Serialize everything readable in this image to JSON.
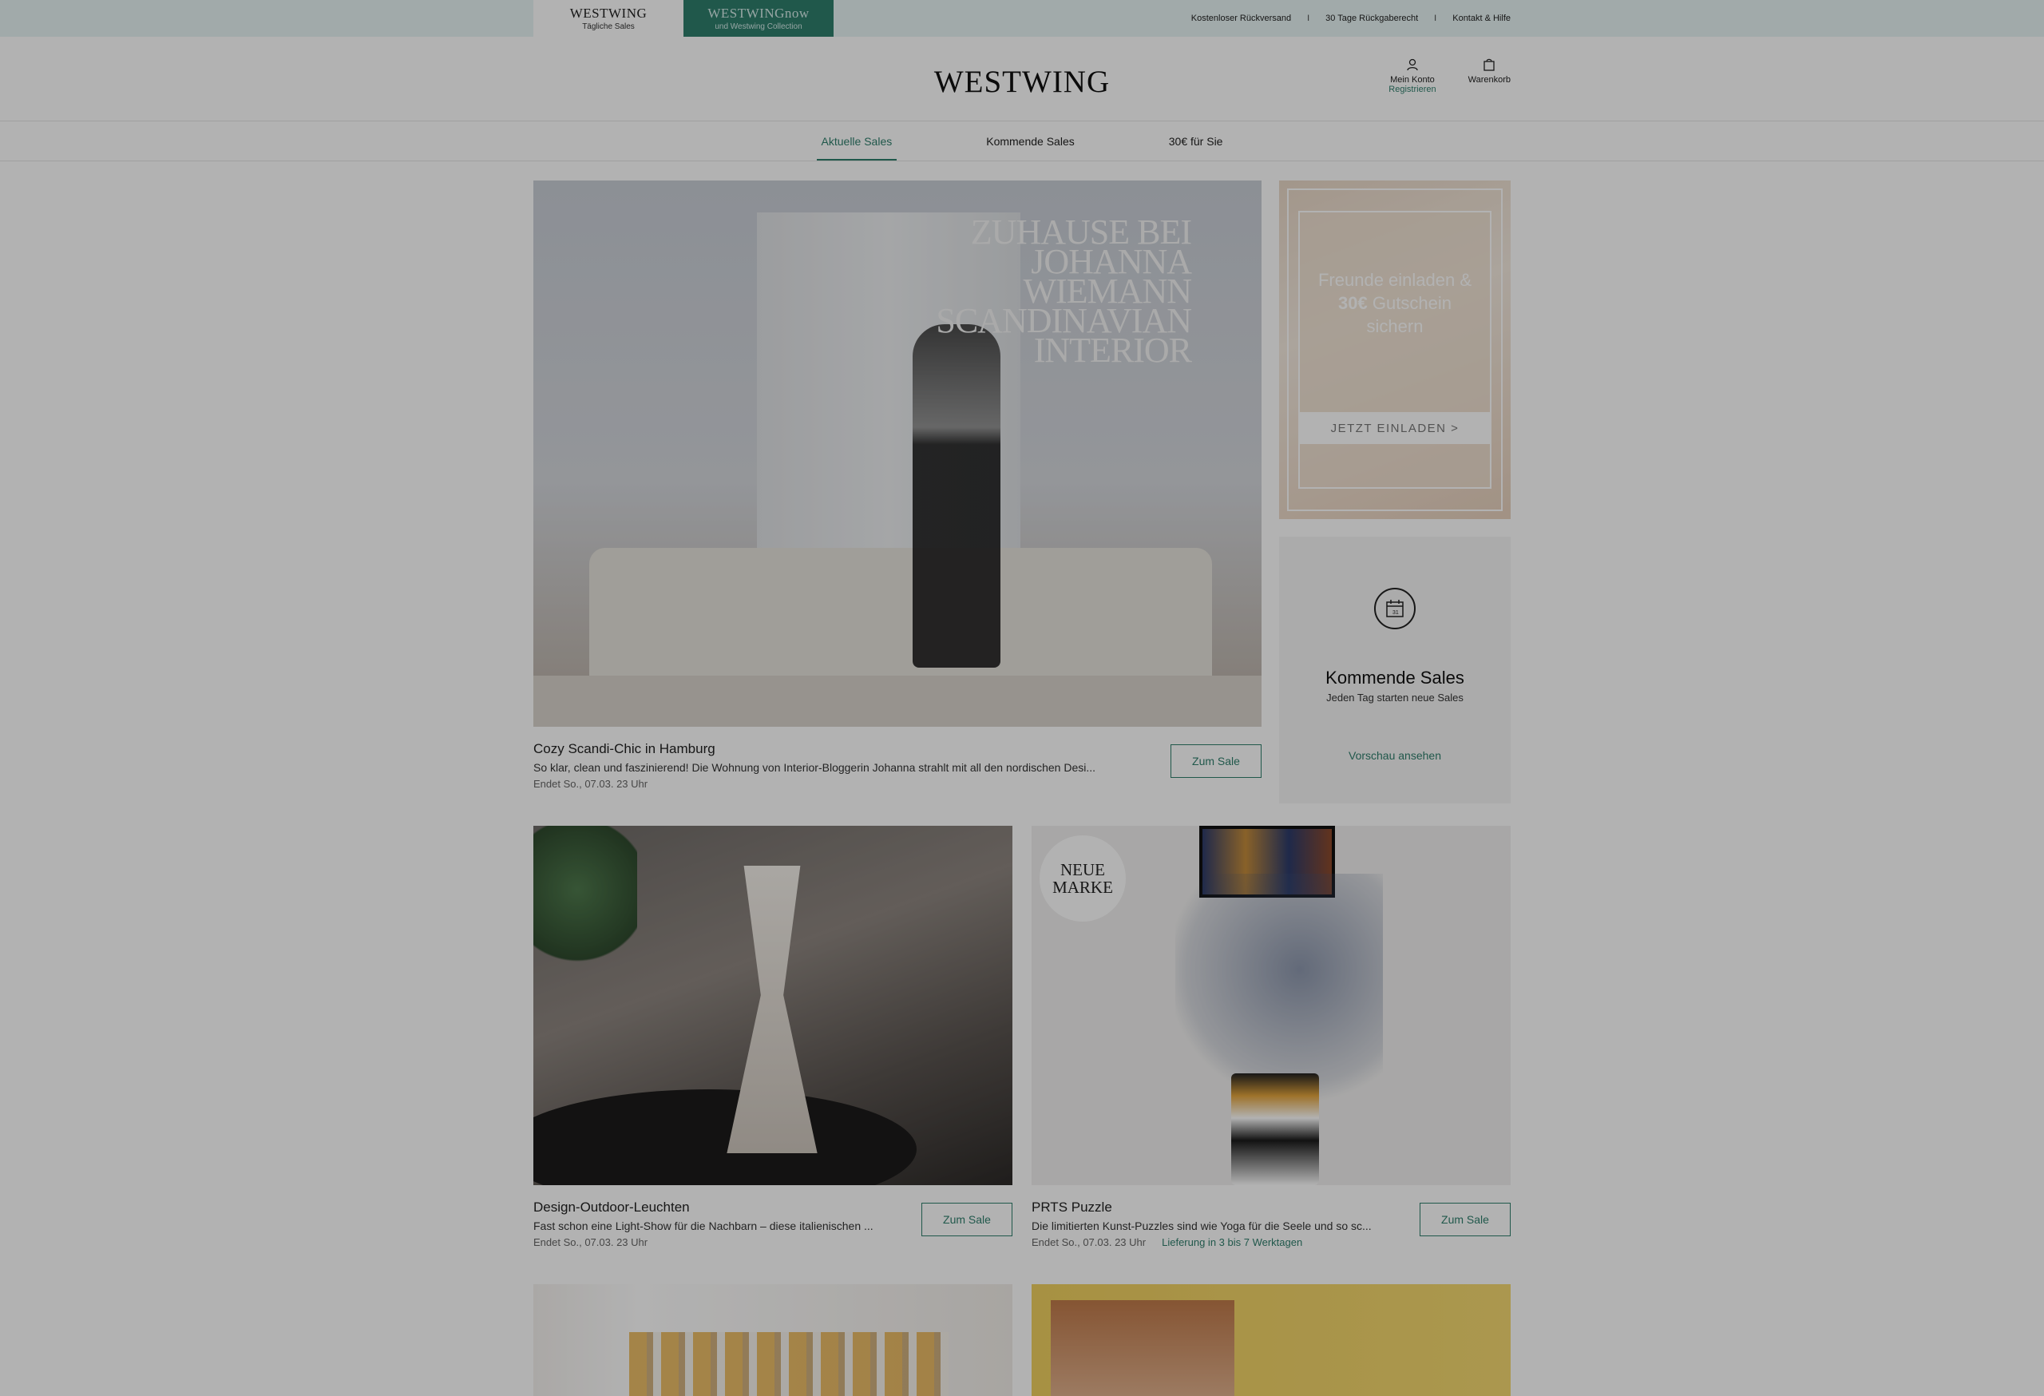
{
  "topbar": {
    "brand_westwing": "WESTWING",
    "brand_westwing_sub": "Tägliche Sales",
    "brand_now": "WESTWINGnow",
    "brand_now_sub": "und Westwing Collection",
    "links": [
      "Kostenloser Rückversand",
      "30 Tage Rückgaberecht",
      "Kontakt & Hilfe"
    ],
    "sep": "I"
  },
  "header": {
    "logo": "WESTWING",
    "account_label": "Mein Konto",
    "account_register": "Registrieren",
    "cart_label": "Warenkorb"
  },
  "nav": {
    "items": [
      "Aktuelle Sales",
      "Kommende Sales",
      "30€ für Sie"
    ],
    "active_index": 0
  },
  "hero": {
    "overlay_lines": [
      "ZUHAUSE BEI",
      "JOHANNA",
      "WIEMANN",
      "SCANDINAVIAN",
      "INTERIOR"
    ],
    "title": "Cozy Scandi-Chic in Hamburg",
    "description": "So klar, clean und faszinierend! Die Wohnung von Interior-Bloggerin Johanna strahlt mit all den nordischen Desi...",
    "ends": "Endet So., 07.03. 23 Uhr",
    "button": "Zum Sale"
  },
  "invite": {
    "line1": "Freunde einladen &",
    "amount": "30€",
    "line2": "Gutschein",
    "line3": "sichern",
    "button": "JETZT EINLADEN >"
  },
  "upcoming": {
    "icon": "calendar-icon",
    "icon_day": "31",
    "title": "Kommende Sales",
    "subtitle": "Jeden Tag starten neue Sales",
    "link": "Vorschau ansehen"
  },
  "tiles": [
    {
      "title": "Design-Outdoor-Leuchten",
      "description": "Fast schon eine Light-Show für die Nachbarn – diese italienischen ...",
      "ends": "Endet So., 07.03. 23 Uhr",
      "button": "Zum Sale"
    },
    {
      "badge_line1": "NEUE",
      "badge_line2": "MARKE",
      "title": "PRTS Puzzle",
      "description": "Die limitierten Kunst-Puzzles sind wie Yoga für die Seele und so sc...",
      "ends": "Endet So., 07.03. 23 Uhr",
      "delivery": "Lieferung in 3 bis 7 Werktagen",
      "button": "Zum Sale"
    }
  ],
  "colors": {
    "accent": "#2f7e6c",
    "topbar_bg": "#e7f4f4",
    "upcoming_bg": "#f5f5f5"
  }
}
